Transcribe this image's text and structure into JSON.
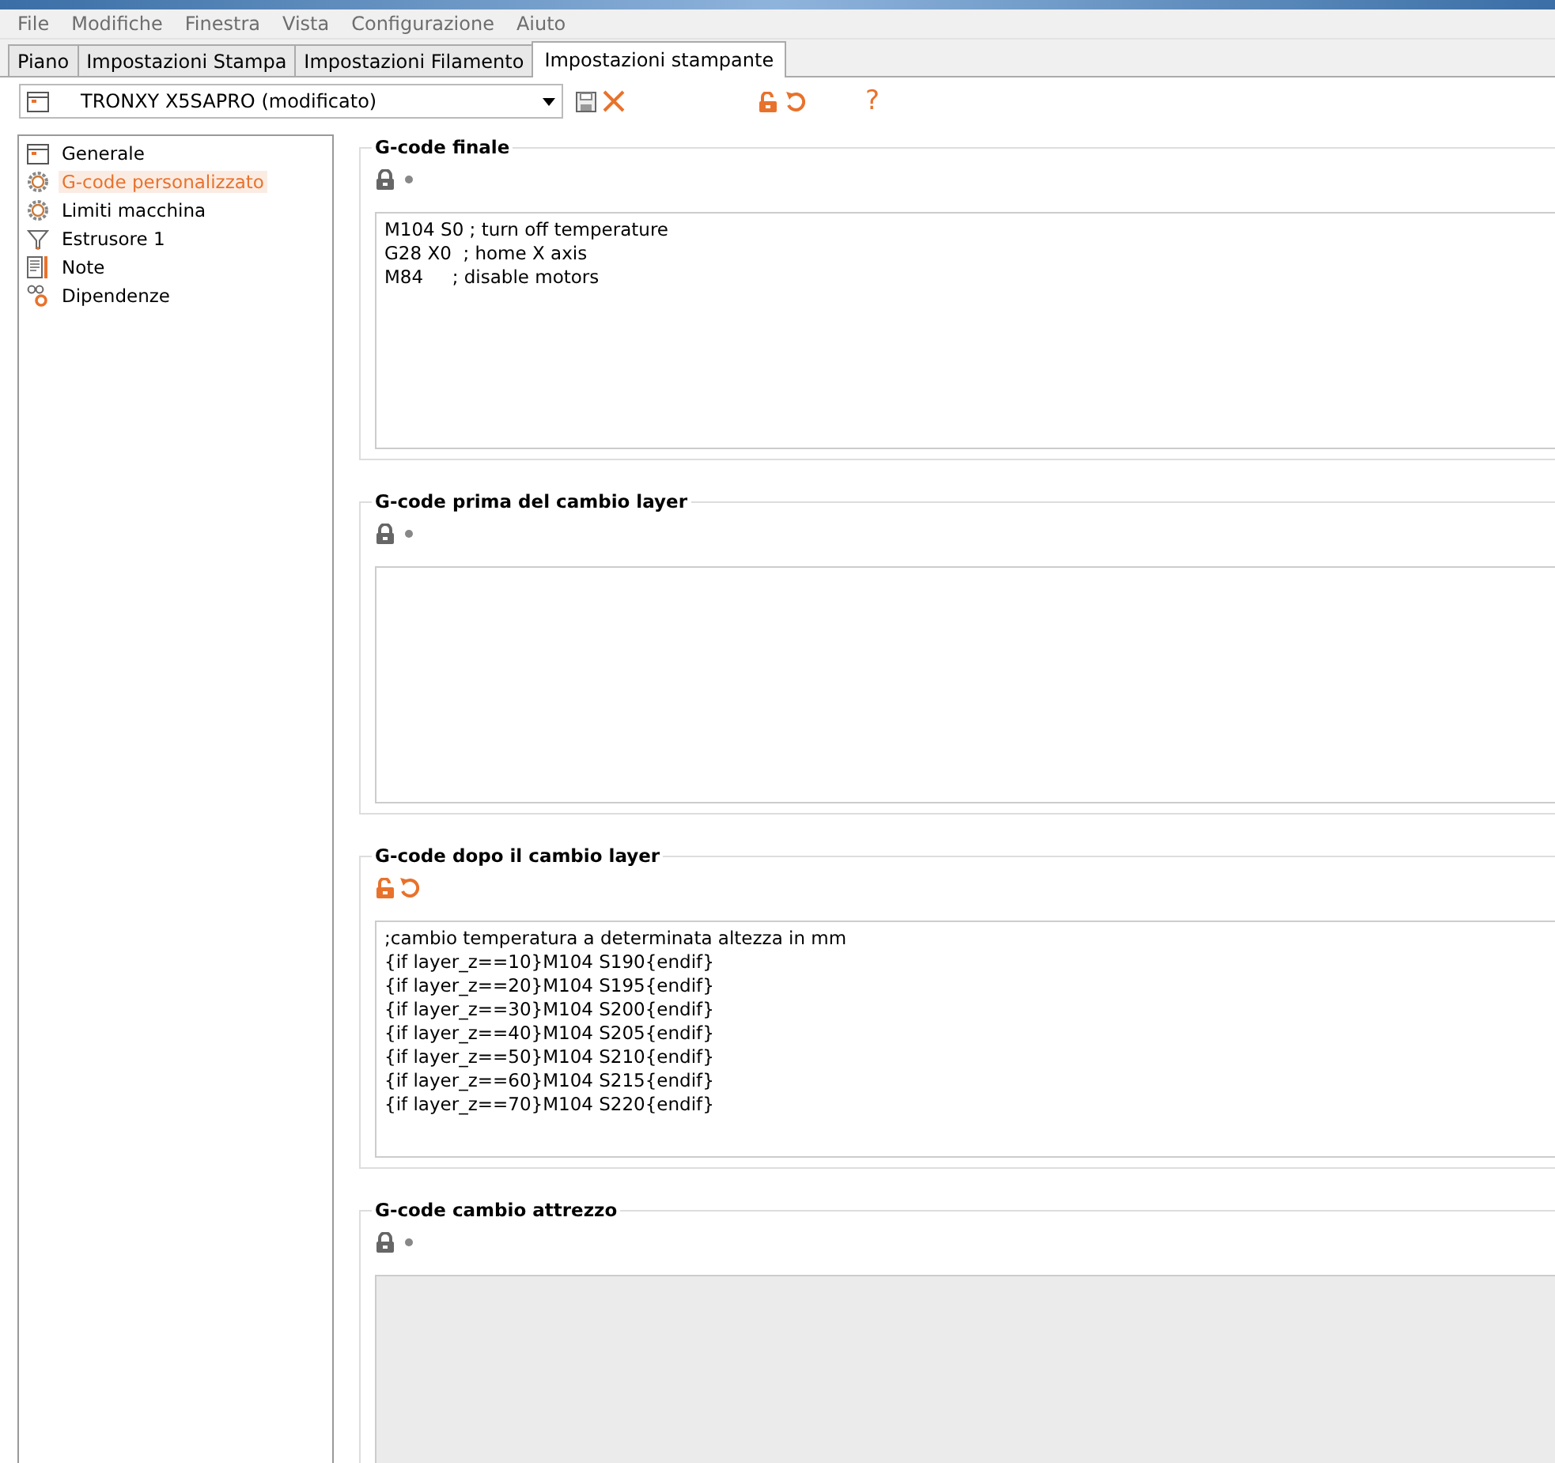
{
  "menu": [
    "File",
    "Modifiche",
    "Finestra",
    "Vista",
    "Configurazione",
    "Aiuto"
  ],
  "tabs": [
    {
      "label": "Piano",
      "selected": false
    },
    {
      "label": "Impostazioni Stampa",
      "selected": false
    },
    {
      "label": "Impostazioni Filamento",
      "selected": false
    },
    {
      "label": "Impostazioni stampante",
      "selected": true
    }
  ],
  "preset": {
    "value": "TRONXY X5SAPRO (modificato)",
    "help": "?"
  },
  "sidebar": {
    "items": [
      {
        "label": "Generale",
        "kind": "window",
        "selected": false
      },
      {
        "label": "G-code personalizzato",
        "kind": "gear",
        "selected": true
      },
      {
        "label": "Limiti macchina",
        "kind": "gear",
        "selected": false
      },
      {
        "label": "Estrusore 1",
        "kind": "funnel",
        "selected": false
      },
      {
        "label": "Note",
        "kind": "note",
        "selected": false
      },
      {
        "label": "Dipendenze",
        "kind": "links",
        "selected": false
      }
    ]
  },
  "sections": [
    {
      "title": "G-code finale",
      "modified": false,
      "disabled": false,
      "lines": [
        "M104 S0 ; turn off temperature",
        "G28 X0  ; home X axis",
        "M84     ; disable motors"
      ]
    },
    {
      "title": "G-code prima del cambio layer",
      "modified": false,
      "disabled": false
    },
    {
      "title": "G-code dopo il cambio layer",
      "modified": true,
      "disabled": false,
      "lines": [
        ";cambio temperatura a determinata altezza in mm",
        "{if layer_z==10}M104 S190{endif}",
        "{if layer_z==20}M104 S195{endif}",
        "{if layer_z==30}M104 S200{endif}",
        "{if layer_z==40}M104 S205{endif}",
        "{if layer_z==50}M104 S210{endif}",
        "{if layer_z==60}M104 S215{endif}",
        "{if layer_z==70}M104 S220{endif}"
      ]
    },
    {
      "title": "G-code cambio attrezzo",
      "modified": false,
      "disabled": true
    }
  ]
}
